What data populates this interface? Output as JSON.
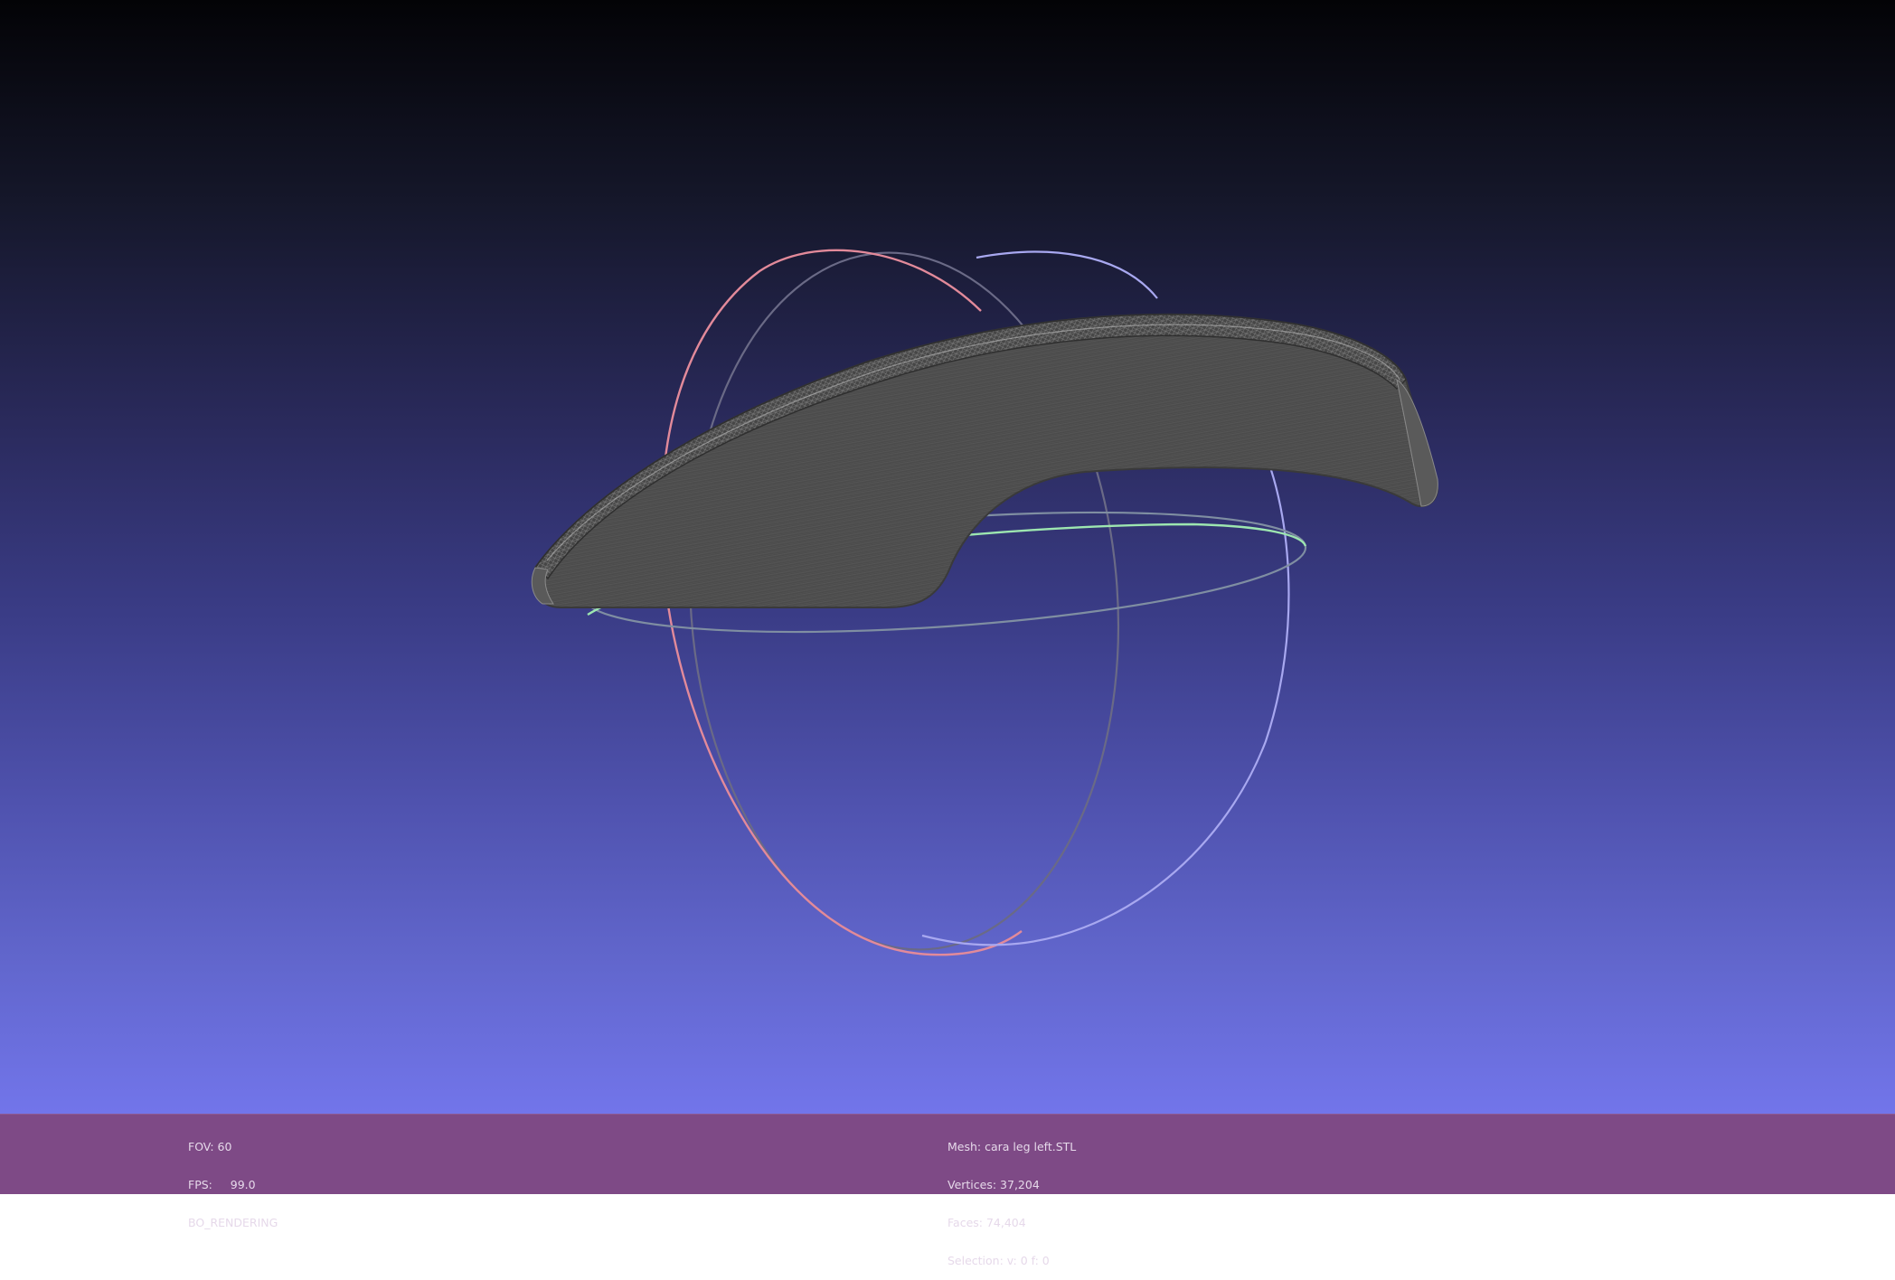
{
  "viewer": {
    "colors": {
      "background_top": "#030306",
      "background_bottom": "#7275ea",
      "info_bar": "#7e4a86",
      "mesh": "#4a4a4a",
      "wire": "#9a9a9a",
      "trackball_x": "#e48a98",
      "trackball_y": "#a6a6ee",
      "trackball_z": "#98e6a6"
    }
  },
  "info_left": {
    "fov": "FOV: 60",
    "fps": "FPS:     99.0",
    "mode": "BO_RENDERING"
  },
  "info_mesh": {
    "mesh": "Mesh: cara leg left.STL",
    "vertices": "Vertices: 37,204",
    "faces": "Faces: 74,404",
    "selection": "Selection: v: 0 f: 0"
  }
}
